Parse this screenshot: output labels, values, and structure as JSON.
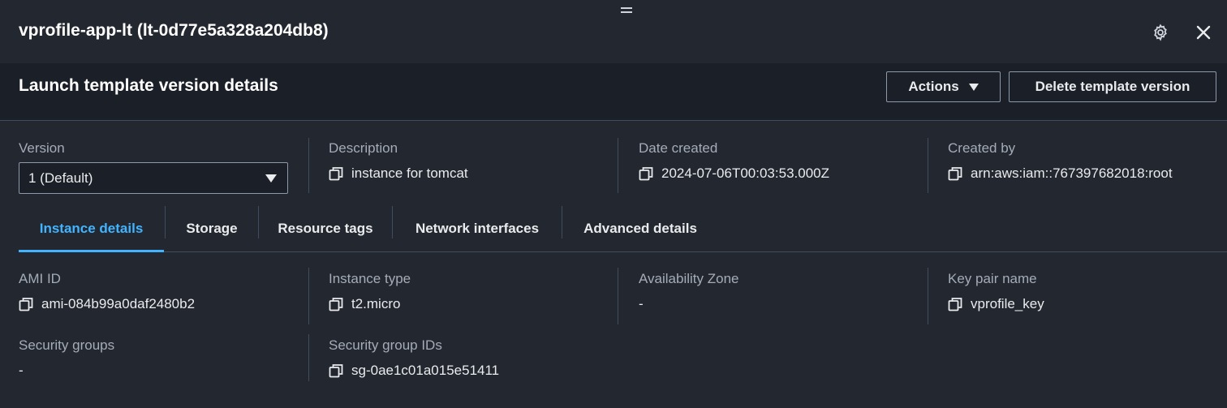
{
  "panel": {
    "title": "vprofile-app-lt (lt-0d77e5a328a204db8)"
  },
  "section": {
    "title": "Launch template version details",
    "actions_label": "Actions",
    "delete_label": "Delete template version"
  },
  "summary": {
    "version_label": "Version",
    "version_value": "1 (Default)",
    "description_label": "Description",
    "description_value": "instance for tomcat",
    "date_label": "Date created",
    "date_value": "2024-07-06T00:03:53.000Z",
    "created_by_label": "Created by",
    "created_by_value": "arn:aws:iam::767397682018:root"
  },
  "tabs": [
    {
      "label": "Instance details",
      "active": true
    },
    {
      "label": "Storage"
    },
    {
      "label": "Resource tags"
    },
    {
      "label": "Network interfaces"
    },
    {
      "label": "Advanced details"
    }
  ],
  "details": {
    "ami_label": "AMI ID",
    "ami_value": "ami-084b99a0daf2480b2",
    "instance_type_label": "Instance type",
    "instance_type_value": "t2.micro",
    "az_label": "Availability Zone",
    "az_value": "-",
    "key_pair_label": "Key pair name",
    "key_pair_value": "vprofile_key",
    "sg_label": "Security groups",
    "sg_value": "-",
    "sg_ids_label": "Security group IDs",
    "sg_ids_value": "sg-0ae1c01a015e51411"
  },
  "icons": {
    "drag": "drag-handle-icon",
    "settings": "gear-icon",
    "close": "close-icon",
    "copy": "copy-icon",
    "dropdown": "caret-down-icon"
  },
  "colors": {
    "background": "#232730",
    "header_background": "#1b1f27",
    "accent": "#42b4ff",
    "label": "#a4acb7",
    "text": "#e9ebed",
    "divider": "#414d5c"
  }
}
